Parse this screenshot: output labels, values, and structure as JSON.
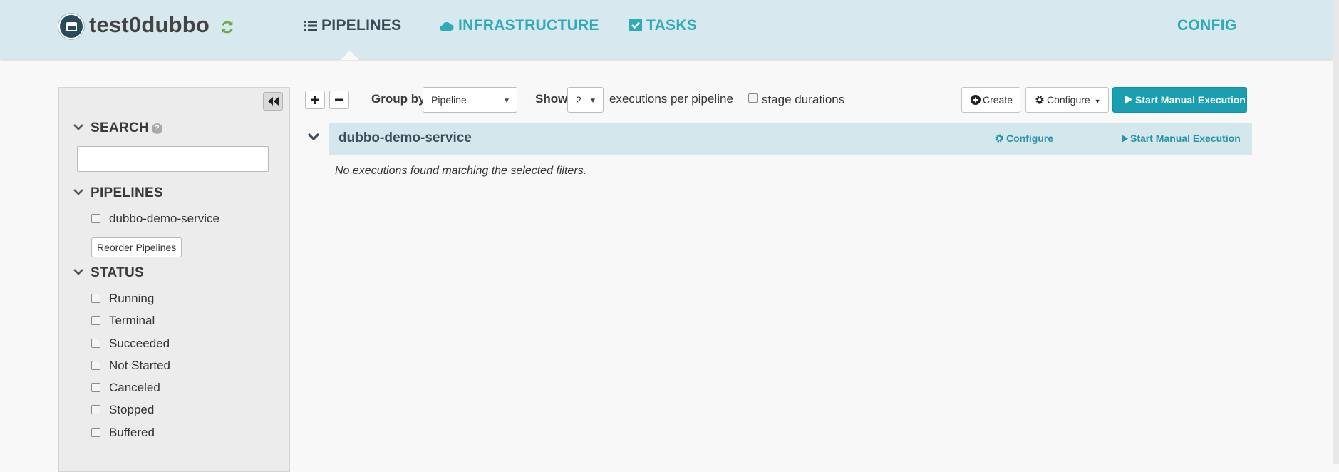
{
  "header": {
    "app_name": "test0dubbo",
    "logo_icon": "window-icon",
    "refresh_icon": "refresh-icon",
    "nav": [
      {
        "label": "PIPELINES",
        "icon": "list-icon",
        "active": true
      },
      {
        "label": "INFRASTRUCTURE",
        "icon": "cloud-icon",
        "active": false
      },
      {
        "label": "TASKS",
        "icon": "check-square-icon",
        "active": false
      }
    ],
    "config_label": "CONFIG"
  },
  "sidebar": {
    "search": {
      "title": "SEARCH",
      "value": "",
      "placeholder": ""
    },
    "pipelines": {
      "title": "PIPELINES",
      "items": [
        "dubbo-demo-service"
      ],
      "reorder_label": "Reorder Pipelines"
    },
    "status": {
      "title": "STATUS",
      "items": [
        "Running",
        "Terminal",
        "Succeeded",
        "Not Started",
        "Canceled",
        "Stopped",
        "Buffered"
      ]
    }
  },
  "toolbar": {
    "group_by_label": "Group by",
    "group_by_value": "Pipeline",
    "show_label": "Show",
    "show_value": "2",
    "executions_text": "executions per pipeline",
    "stage_durations_label": "stage durations",
    "create_label": "Create",
    "configure_label": "Configure",
    "start_label": "Start Manual Execution"
  },
  "pipeline_group": {
    "name": "dubbo-demo-service",
    "configure_label": "Configure",
    "start_label": "Start Manual Execution",
    "empty_message": "No executions found matching the selected filters."
  },
  "colors": {
    "header_bg": "#d7e8ee",
    "accent": "#2eaab8",
    "primary_button": "#1a9fb2",
    "refresh_green": "#6aa84f"
  }
}
